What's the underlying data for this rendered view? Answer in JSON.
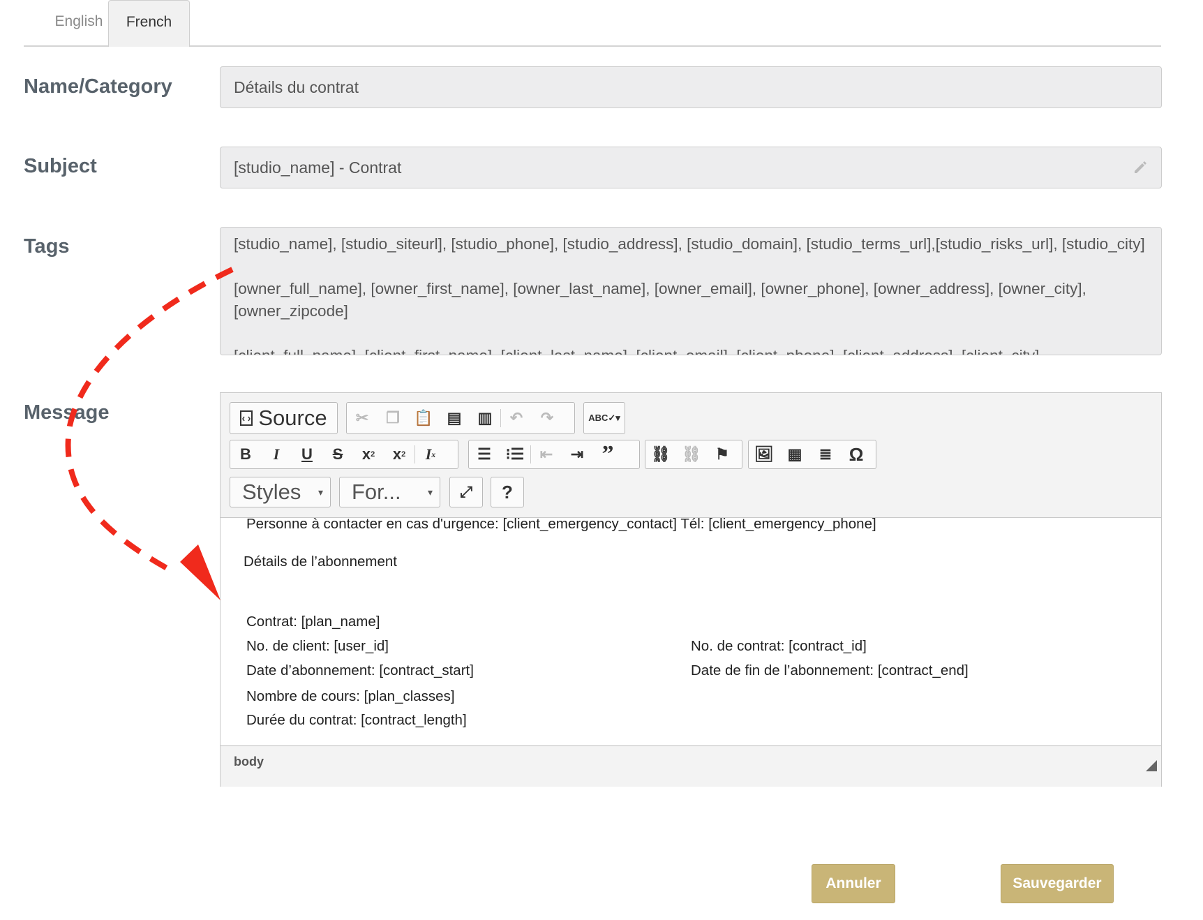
{
  "tabs": {
    "english": "English",
    "french": "French"
  },
  "labels": {
    "name": "Name/Category",
    "subject": "Subject",
    "tags": "Tags",
    "message": "Message"
  },
  "fields": {
    "name": "Détails du contrat",
    "subject": "[studio_name] - Contrat",
    "tags_lines": [
      "[studio_name], [studio_siteurl], [studio_phone], [studio_address], [studio_domain], [studio_terms_url],[studio_risks_url], [studio_city]",
      "[owner_full_name], [owner_first_name], [owner_last_name], [owner_email], [owner_phone], [owner_address], [owner_city], [owner_zipcode]",
      "[client_full_name], [client_first_name], [client_last_name], [client_email], [client_phone], [client_address], [client_city]"
    ]
  },
  "editor": {
    "source_label": "Source",
    "styles_label": "Styles",
    "format_label": "For...",
    "help_label": "?",
    "status_path": "body",
    "content": {
      "emergency": "Personne à contacter en cas d'urgence: [client_emergency_contact]  Tél: [client_emergency_phone]",
      "section_title": "Détails de l’abonnement",
      "contract": "Contrat: [plan_name]",
      "client_no": "No. de client: [user_id]",
      "contract_no": "No. de contrat: [contract_id]",
      "start_date": "Date d’abonnement: [contract_start]",
      "end_date": "Date de fin de l’abonnement: [contract_end]",
      "classes": "Nombre de cours: [plan_classes]",
      "length": "Durée du contrat: [contract_length]"
    }
  },
  "buttons": {
    "cancel": "Annuler",
    "save": "Sauvegarder"
  },
  "colors": {
    "accent": "#c9b577",
    "annotation": "#f02a1c"
  },
  "icons": [
    "source-icon",
    "cut-icon",
    "copy-icon",
    "paste-icon",
    "paste-text-icon",
    "paste-word-icon",
    "undo-icon",
    "redo-icon",
    "spellcheck-icon",
    "bold-icon",
    "italic-icon",
    "underline-icon",
    "strike-icon",
    "subscript-icon",
    "superscript-icon",
    "remove-format-icon",
    "numbered-list-icon",
    "bullet-list-icon",
    "outdent-icon",
    "indent-icon",
    "blockquote-icon",
    "link-icon",
    "unlink-icon",
    "anchor-icon",
    "image-icon",
    "table-icon",
    "horizontal-rule-icon",
    "special-char-icon",
    "maximize-icon",
    "pencil-icon"
  ]
}
